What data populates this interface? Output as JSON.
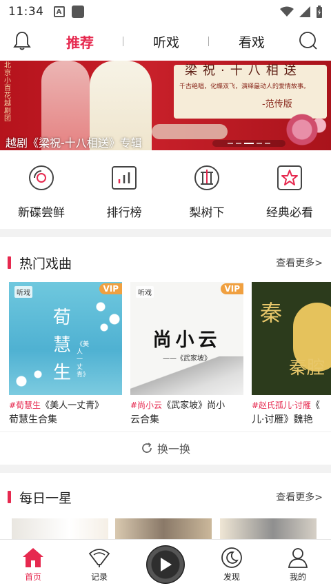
{
  "status_bar": {
    "time": "11:34",
    "notif_letter": "A"
  },
  "top_nav": {
    "tabs": [
      {
        "label": "推荐",
        "active": true
      },
      {
        "label": "听戏",
        "active": false
      },
      {
        "label": "看戏",
        "active": false
      }
    ]
  },
  "banner": {
    "vertical_text": "北京小百花越剧团",
    "panel_title": "梁祝·十八相送",
    "panel_sub": "千古绝唱，化蝶双飞，演绎最动人的爱情故事。",
    "panel_version": "-范传版",
    "caption": "越剧《梁祝-十八相送》专辑",
    "slide_count": 5,
    "active_slide": 2
  },
  "quick_menu": [
    {
      "label": "新碟尝鲜",
      "icon": "disc-icon"
    },
    {
      "label": "排行榜",
      "icon": "chart-icon"
    },
    {
      "label": "梨树下",
      "icon": "pear-tree-icon"
    },
    {
      "label": "经典必看",
      "icon": "star-icon"
    }
  ],
  "hot_section": {
    "title": "热门戏曲",
    "more": "查看更多>",
    "cards": [
      {
        "vip": "VIP",
        "brand": "听戏",
        "cover_title": "荀慧生",
        "cover_sub": "《美人一丈青》",
        "tag": "#荀慧生",
        "line1": "《美人一丈青》",
        "line2": "荀慧生合集"
      },
      {
        "vip": "VIP",
        "brand": "听戏",
        "cover_title": "尚小云",
        "cover_sub": "——《武家坡》",
        "tag": "#尚小云",
        "line1": "《武家坡》尚小",
        "line2": "云合集"
      },
      {
        "vip": "",
        "brand": "",
        "cover_title": "秦",
        "cover_sub": "秦腔",
        "tag": "#赵氏孤儿·讨雁",
        "line1": "《",
        "line2": "儿·讨雁》魏艳"
      }
    ],
    "swap_label": "换一换"
  },
  "daily_section": {
    "title": "每日一星",
    "more": "查看更多>"
  },
  "bottom_nav": [
    {
      "label": "首页",
      "icon": "home-icon",
      "active": true
    },
    {
      "label": "记录",
      "icon": "fan-icon",
      "active": false
    },
    {
      "label": "",
      "icon": "play-icon",
      "active": false
    },
    {
      "label": "发现",
      "icon": "moon-icon",
      "active": false
    },
    {
      "label": "我的",
      "icon": "user-icon",
      "active": false
    }
  ],
  "colors": {
    "accent": "#e6294f",
    "banner_red": "#c8202a",
    "vip": "#f0a040"
  }
}
